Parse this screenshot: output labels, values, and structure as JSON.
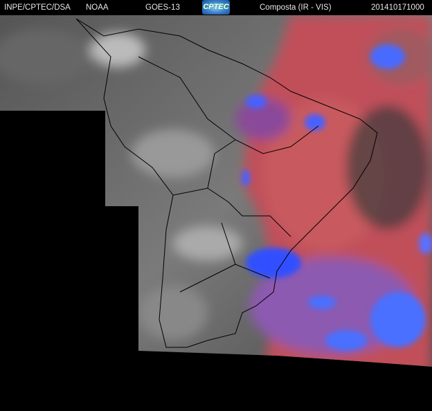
{
  "header": {
    "agency": "INPE/CPTEC/DSA",
    "source": "NOAA",
    "satellite": "GOES-13",
    "logo_text": "CPTEC",
    "product": "Composta (IR - VIS)",
    "timestamp": "201410171000"
  },
  "colors": {
    "background": "#000000",
    "cloud_gray": "#8a8a8a",
    "ir_red": "#c8505a",
    "ir_magenta": "#9a4a9a",
    "cold_blue": "#3a5cff"
  }
}
